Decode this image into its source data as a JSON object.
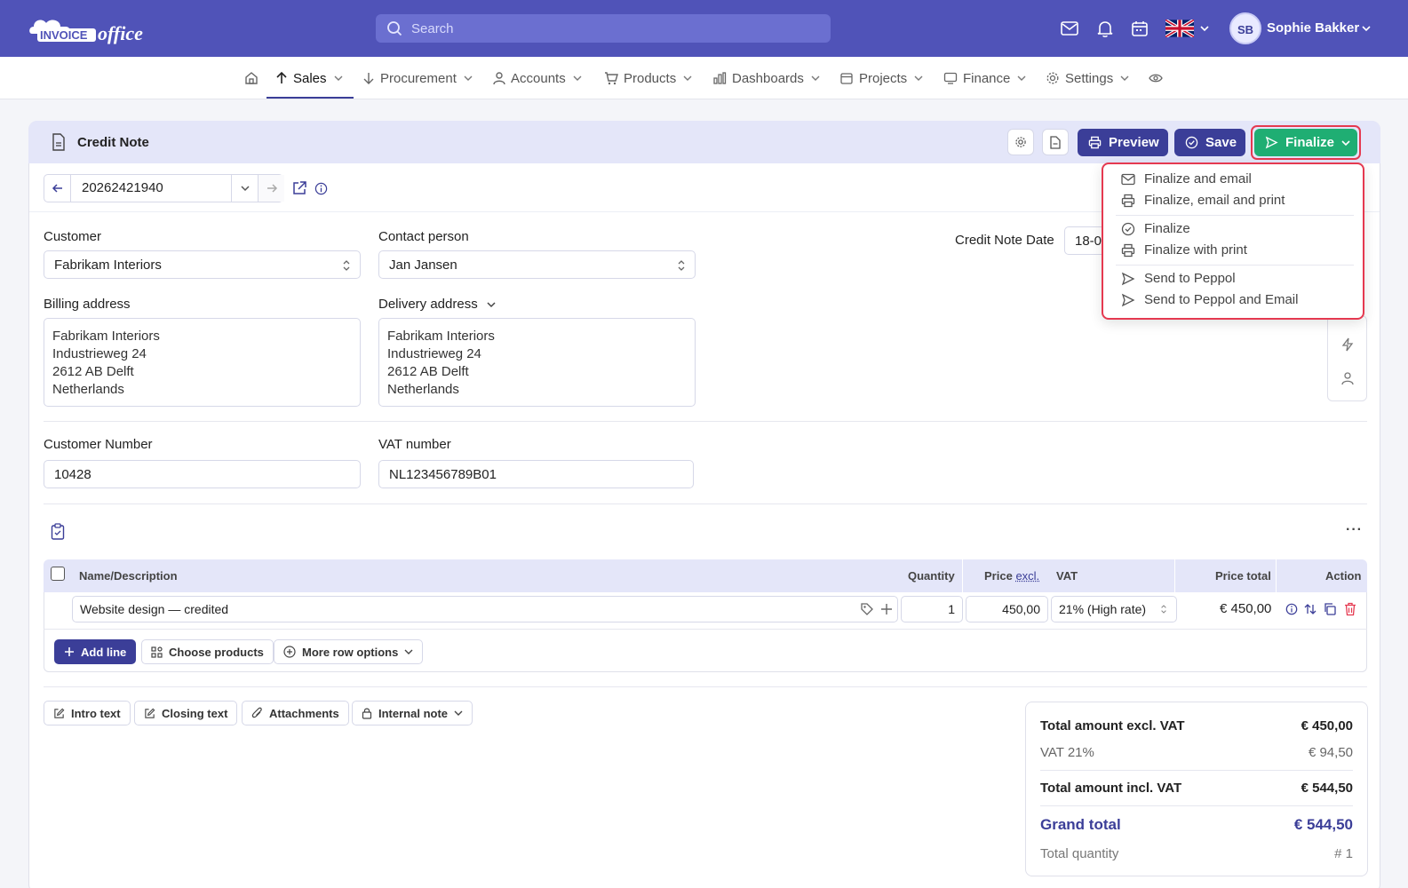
{
  "header": {
    "logo_text": "INVOICEoffice",
    "search_placeholder": "Search",
    "user_initials": "SB",
    "user_name": "Sophie Bakker"
  },
  "nav": {
    "items": [
      {
        "label": "Sales"
      },
      {
        "label": "Procurement"
      },
      {
        "label": "Accounts"
      },
      {
        "label": "Products"
      },
      {
        "label": "Dashboards"
      },
      {
        "label": "Projects"
      },
      {
        "label": "Finance"
      },
      {
        "label": "Settings"
      }
    ]
  },
  "card": {
    "title": "Credit Note",
    "preview_label": "Preview",
    "save_label": "Save",
    "finalize_label": "Finalize"
  },
  "finalize_menu": [
    {
      "label": "Finalize and email",
      "icon": "mail-icon"
    },
    {
      "label": "Finalize, email and print",
      "icon": "printer-icon"
    },
    {
      "label": "Finalize",
      "icon": "check-circle-icon"
    },
    {
      "label": "Finalize with print",
      "icon": "printer-icon"
    },
    {
      "label": "Send to Peppol",
      "icon": "send-icon"
    },
    {
      "label": "Send to Peppol and Email",
      "icon": "send-icon"
    }
  ],
  "document": {
    "number": "20262421940"
  },
  "form": {
    "customer_label": "Customer",
    "customer_value": "Fabrikam Interiors",
    "contact_label": "Contact person",
    "contact_value": "Jan Jansen",
    "date_label": "Credit Note Date",
    "date_value_partial": "18-0",
    "billing_label": "Billing address",
    "billing_lines": [
      "Fabrikam Interiors",
      "Industrieweg 24",
      "2612 AB Delft",
      "Netherlands"
    ],
    "delivery_label": "Delivery address",
    "delivery_lines": [
      "Fabrikam Interiors",
      "Industrieweg 24",
      "2612 AB Delft",
      "Netherlands"
    ],
    "customer_number_label": "Customer Number",
    "customer_number_value": "10428",
    "vat_number_label": "VAT number",
    "vat_number_value": "NL123456789B01"
  },
  "table": {
    "headers": {
      "name": "Name/Description",
      "quantity": "Quantity",
      "price": "Price",
      "price_suffix": "excl.",
      "vat": "VAT",
      "price_total": "Price total",
      "action": "Action"
    },
    "rows": [
      {
        "description": "Website design — credited",
        "quantity": "1",
        "price": "450,00",
        "vat": "21% (High rate)",
        "total": "€ 450,00"
      }
    ],
    "add_line_label": "Add line",
    "choose_products_label": "Choose products",
    "more_row_options_label": "More row options"
  },
  "footer_buttons": {
    "intro": "Intro text",
    "closing": "Closing text",
    "attachments": "Attachments",
    "internal_note": "Internal note"
  },
  "totals": {
    "excl_label": "Total amount excl. VAT",
    "excl_value": "€ 450,00",
    "vat_label": "VAT 21%",
    "vat_value": "€ 94,50",
    "incl_label": "Total amount incl. VAT",
    "incl_value": "€ 544,50",
    "grand_label": "Grand total",
    "grand_value": "€ 544,50",
    "qty_label": "Total quantity",
    "qty_value": "# 1"
  },
  "colors": {
    "brand": "#5053b8",
    "primary_button": "#3b3e98",
    "finalize_button": "#1fae73",
    "highlight": "#e53950"
  }
}
